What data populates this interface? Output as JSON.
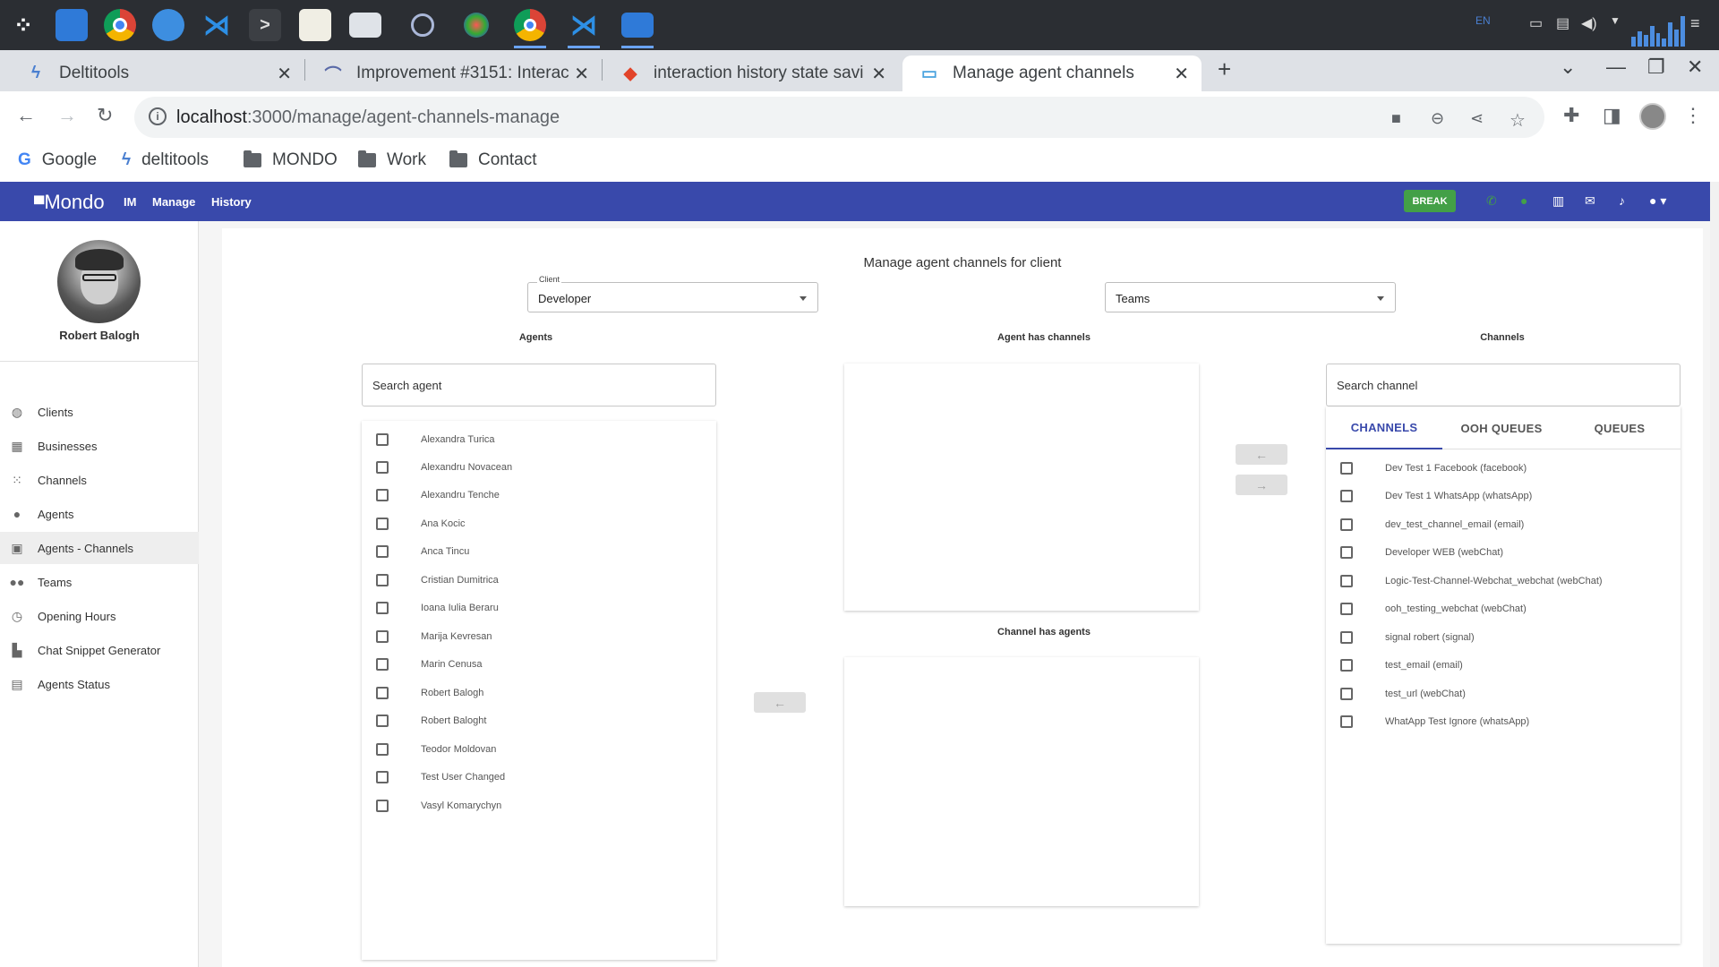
{
  "taskbar": {
    "apps": [
      "app-launcher",
      "file-manager",
      "chrome",
      "thunderbird",
      "vscode",
      "terminal",
      "text-editor",
      "display-settings",
      "timer",
      "color-picker",
      "chrome-active",
      "vscode-2",
      "file-manager-2"
    ],
    "tray_lang": "EN"
  },
  "browser": {
    "tabs": [
      {
        "title": "Deltitools",
        "icon": "deltitools-icon"
      },
      {
        "title": "Improvement #3151: Interac",
        "icon": "redmine-icon"
      },
      {
        "title": "interaction history state savi",
        "icon": "gitlab-icon"
      },
      {
        "title": "Manage agent channels",
        "icon": "chat-icon"
      }
    ],
    "new_tab": "+",
    "url_host": "localhost",
    "url_path": ":3000/manage/agent-channels-manage",
    "bookmarks": [
      "Google",
      "deltitools",
      "MONDO",
      "Work",
      "Contact"
    ]
  },
  "app": {
    "logo": "Mondo",
    "nav": [
      "IM",
      "Manage",
      "History"
    ],
    "break_label": "BREAK",
    "colors": {
      "primary": "#3949ab",
      "break": "#43a047",
      "phone": "#43a047"
    }
  },
  "sidebar": {
    "user_name": "Robert Balogh",
    "items": [
      {
        "label": "Clients",
        "icon": "globe-icon"
      },
      {
        "label": "Businesses",
        "icon": "building-icon"
      },
      {
        "label": "Channels",
        "icon": "grid-icon"
      },
      {
        "label": "Agents",
        "icon": "person-icon"
      },
      {
        "label": "Agents - Channels",
        "icon": "contact-card-icon"
      },
      {
        "label": "Teams",
        "icon": "group-icon"
      },
      {
        "label": "Opening Hours",
        "icon": "clock-icon"
      },
      {
        "label": "Chat Snippet Generator",
        "icon": "snippet-icon"
      },
      {
        "label": "Agents Status",
        "icon": "id-card-icon"
      }
    ]
  },
  "main": {
    "title": "Manage agent channels for client",
    "client_label": "Client",
    "client_value": "Developer",
    "teams_value": "Teams",
    "agents_title": "Agents",
    "agent_channels_title": "Agent has channels",
    "channel_agents_title": "Channel has agents",
    "channels_title": "Channels",
    "search_agent_placeholder": "Search agent",
    "search_channel_placeholder": "Search channel",
    "agents": [
      "Alexandra Turica",
      "Alexandru Novacean",
      "Alexandru Tenche",
      "Ana Kocic",
      "Anca Tincu",
      "Cristian Dumitrica",
      "Ioana Iulia Beraru",
      "Marija Kevresan",
      "Marin Cenusa",
      "Robert Balogh",
      "Robert Baloght",
      "Teodor Moldovan",
      "Test User Changed",
      "Vasyl Komarychyn"
    ],
    "channel_tabs": [
      "CHANNELS",
      "OOH QUEUES",
      "QUEUES"
    ],
    "channels": [
      "Dev Test 1 Facebook (facebook)",
      "Dev Test 1 WhatsApp (whatsApp)",
      "dev_test_channel_email (email)",
      "Developer WEB (webChat)",
      "Logic-Test-Channel-Webchat_webchat (webChat)",
      "ooh_testing_webchat (webChat)",
      "signal robert (signal)",
      "test_email (email)",
      "test_url (webChat)",
      "WhatApp Test Ignore (whatsApp)"
    ],
    "arrow_left": "←",
    "arrow_right": "→"
  }
}
